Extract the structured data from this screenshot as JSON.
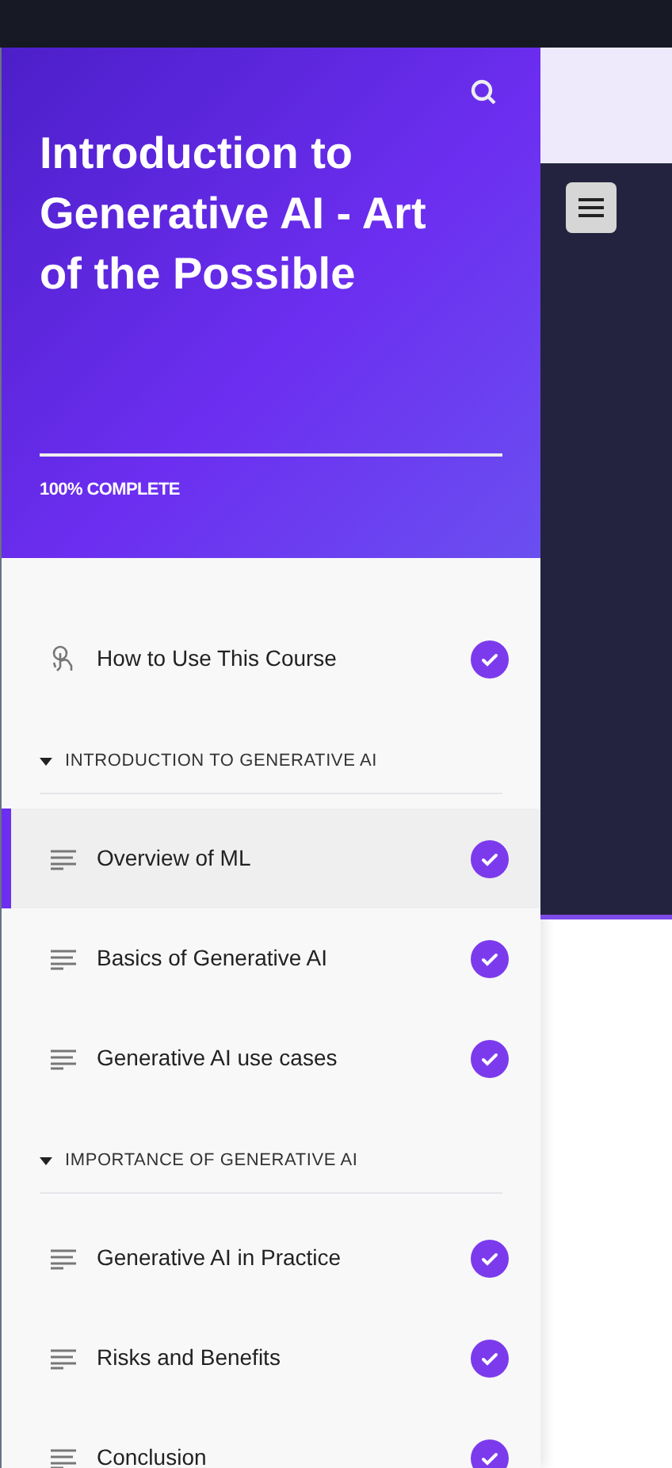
{
  "course": {
    "title": "Introduction to Generative AI - Art of the Possible",
    "progress_label": "100% COMPLETE"
  },
  "outline": [
    {
      "kind": "intro",
      "title": "How to Use This Course",
      "completed": true,
      "selected": false
    },
    {
      "kind": "section",
      "title": "INTRODUCTION TO GENERATIVE AI",
      "expanded": true
    },
    {
      "kind": "lesson",
      "title": "Overview of ML",
      "completed": true,
      "selected": true
    },
    {
      "kind": "lesson",
      "title": "Basics of Generative AI",
      "completed": true,
      "selected": false
    },
    {
      "kind": "lesson",
      "title": "Generative AI use cases",
      "completed": true,
      "selected": false
    },
    {
      "kind": "section",
      "title": "IMPORTANCE OF GENERATIVE AI",
      "expanded": true
    },
    {
      "kind": "lesson",
      "title": "Generative AI in Practice",
      "completed": true,
      "selected": false
    },
    {
      "kind": "lesson",
      "title": "Risks and Benefits",
      "completed": true,
      "selected": false
    },
    {
      "kind": "lesson",
      "title": "Conclusion",
      "completed": true,
      "selected": false
    }
  ]
}
